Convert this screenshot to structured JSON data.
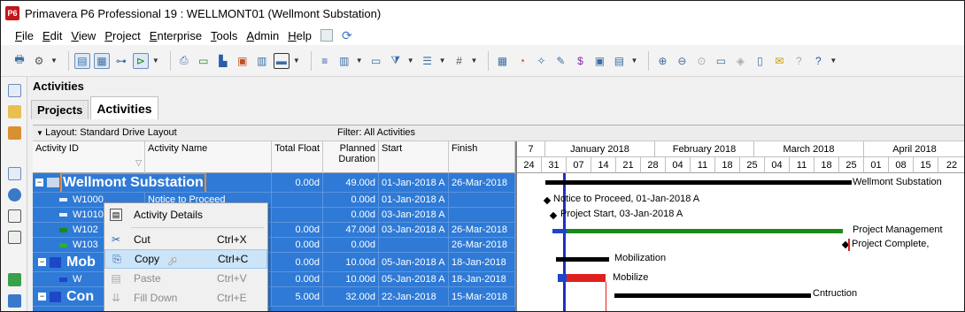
{
  "window": {
    "app_icon": "P6",
    "title": "Primavera P6 Professional 19 : WELLMONT01 (Wellmont Substation)"
  },
  "menu": [
    {
      "hot": "F",
      "rest": "ile"
    },
    {
      "hot": "E",
      "rest": "dit"
    },
    {
      "hot": "V",
      "rest": "iew"
    },
    {
      "hot": "P",
      "rest": "roject"
    },
    {
      "hot": "E",
      "rest": "nterprise"
    },
    {
      "hot": "T",
      "rest": "ools"
    },
    {
      "hot": "A",
      "rest": "dmin"
    },
    {
      "hot": "H",
      "rest": "elp"
    }
  ],
  "panel": {
    "title": "Activities"
  },
  "tabs": {
    "projects": "Projects",
    "activities": "Activities"
  },
  "layoutbar": {
    "layout": "Layout: Standard Drive Layout",
    "filter": "Filter: All Activities"
  },
  "columns": {
    "activity_id": "Activity ID",
    "activity_name": "Activity Name",
    "total_float": "Total Float",
    "planned_duration_1": "Planned",
    "planned_duration_2": "Duration",
    "start": "Start",
    "finish": "Finish"
  },
  "rows": [
    {
      "id": "Wellmont Substation",
      "name": "",
      "float": "0.00d",
      "duration": "49.00d",
      "start": "01-Jan-2018 A",
      "finish": "26-Mar-2018"
    },
    {
      "id": "W1000",
      "name": "Notice to Proceed",
      "float": "",
      "duration": "0.00d",
      "start": "01-Jan-2018 A",
      "finish": ""
    },
    {
      "id": "W1010",
      "name": "",
      "float": "",
      "duration": "0.00d",
      "start": "03-Jan-2018 A",
      "finish": ""
    },
    {
      "id": "W102",
      "name": "",
      "float": "0.00d",
      "duration": "47.00d",
      "start": "03-Jan-2018 A",
      "finish": "26-Mar-2018"
    },
    {
      "id": "W103",
      "name": "",
      "float": "0.00d",
      "duration": "0.00d",
      "start": "",
      "finish": "26-Mar-2018"
    },
    {
      "id": "Mob",
      "name": "",
      "float": "0.00d",
      "duration": "10.00d",
      "start": "05-Jan-2018 A",
      "finish": "18-Jan-2018"
    },
    {
      "id": "W",
      "name": "",
      "float": "0.00d",
      "duration": "10.00d",
      "start": "05-Jan-2018 A",
      "finish": "18-Jan-2018"
    },
    {
      "id": "Con",
      "name": "",
      "float": "5.00d",
      "duration": "32.00d",
      "start": "22-Jan-2018",
      "finish": "15-Mar-2018"
    }
  ],
  "timescale": {
    "months": [
      "January 2018",
      "February 2018",
      "March 2018",
      "April 2018"
    ],
    "days": [
      "24",
      "31",
      "07",
      "14",
      "21",
      "28",
      "04",
      "11",
      "18",
      "25",
      "04",
      "11",
      "18",
      "25",
      "01",
      "08",
      "15",
      "22"
    ]
  },
  "gantt_labels": {
    "wbs": "Wellmont Substation",
    "ntp": "Notice to Proceed, 01-Jan-2018 A",
    "start": "Project Start, 03-Jan-2018 A",
    "pm": "Project Management",
    "complete": "Project Complete,",
    "mobilization": "Mobilization",
    "mobilize": "Mobilize",
    "construction": "Cntruction"
  },
  "context_menu": {
    "details": "Activity Details",
    "cut": "Cut",
    "cut_sc": "Ctrl+X",
    "copy": "Copy",
    "copy_sc": "Ctrl+C",
    "paste": "Paste",
    "paste_sc": "Ctrl+V",
    "filldown": "Fill Down",
    "filldown_sc": "Ctrl+E"
  },
  "colors": {
    "selection": "#2f7ad6",
    "critical_bar": "#e02020",
    "progress_bar": "#1a8a1a",
    "data_date": "#1f2fc8"
  }
}
